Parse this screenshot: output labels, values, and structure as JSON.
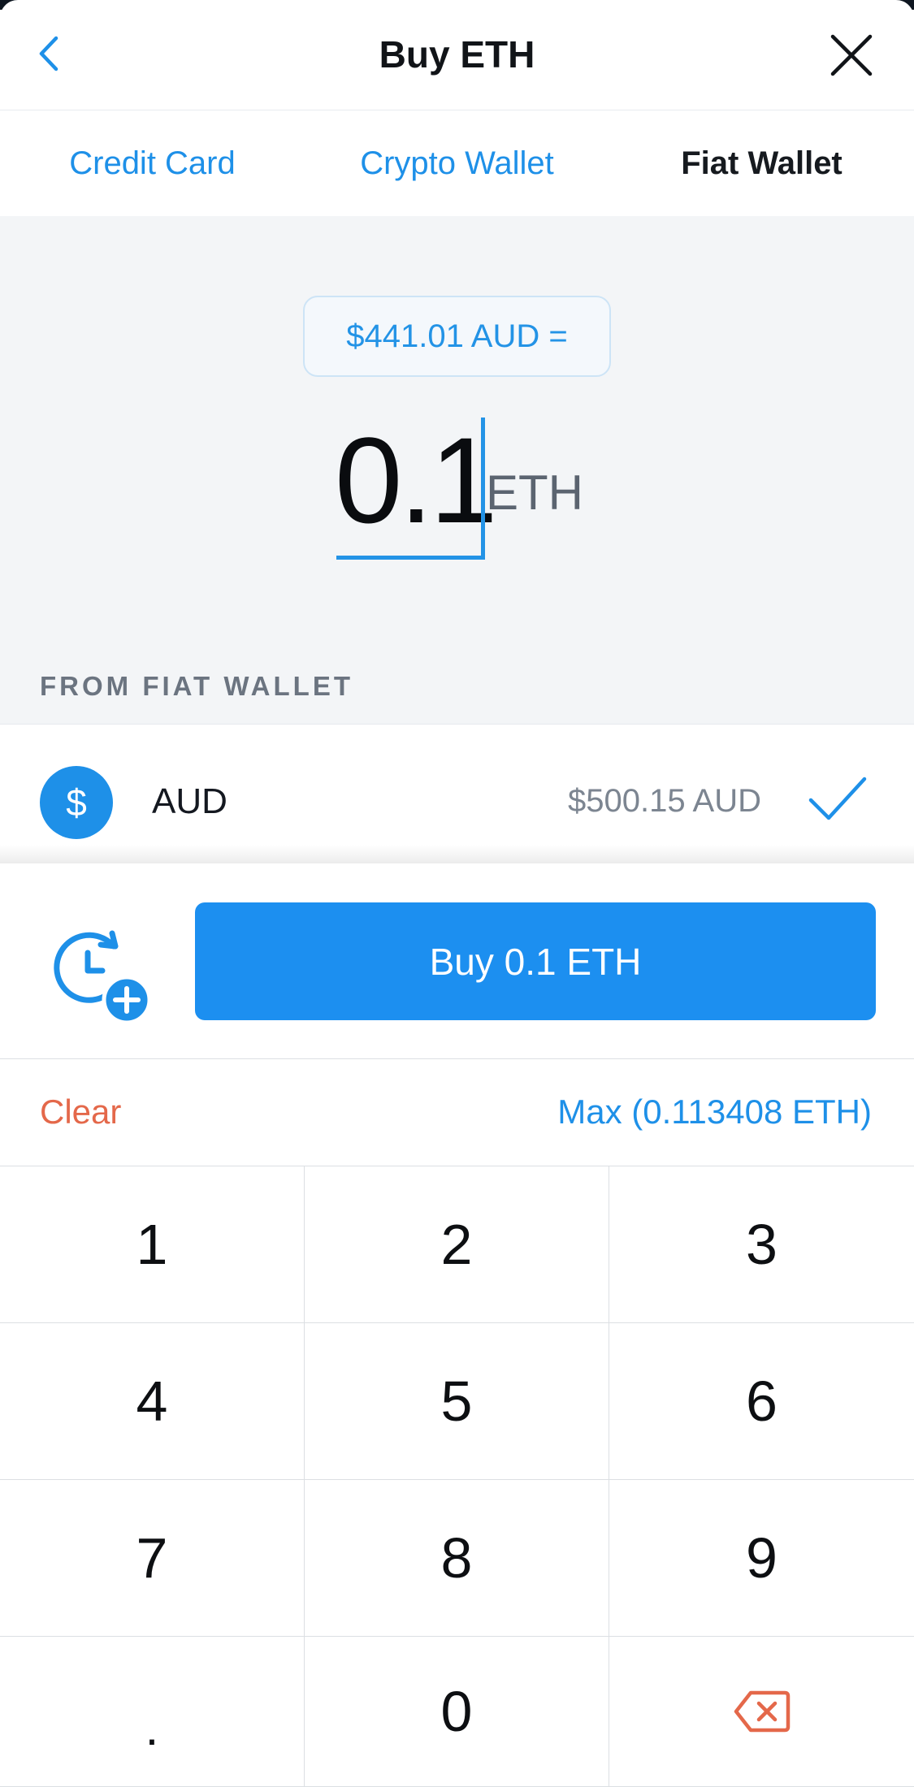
{
  "header": {
    "title": "Buy ETH",
    "back_icon": "chevron-left-icon",
    "close_icon": "close-icon"
  },
  "tabs": [
    {
      "label": "Credit Card",
      "active": false
    },
    {
      "label": "Crypto Wallet",
      "active": false
    },
    {
      "label": "Fiat Wallet",
      "active": true
    }
  ],
  "amount": {
    "rate_label": "$441.01 AUD =",
    "value": "0.1",
    "unit": "ETH"
  },
  "source": {
    "section_label": "FROM FIAT WALLET",
    "wallet": {
      "icon_symbol": "$",
      "name": "AUD",
      "balance": "$500.15 AUD",
      "selected": true
    }
  },
  "actions": {
    "schedule_icon": "recurring-buy-icon",
    "buy_label": "Buy 0.1 ETH"
  },
  "quick": {
    "clear_label": "Clear",
    "max_label": "Max (0.113408 ETH)"
  },
  "keypad": {
    "keys": [
      "1",
      "2",
      "3",
      "4",
      "5",
      "6",
      "7",
      "8",
      "9",
      ".",
      "0"
    ],
    "backspace_icon": "backspace-icon"
  },
  "colors": {
    "accent": "#1e90e8",
    "danger": "#e4684a",
    "background": "#f3f5f7"
  }
}
